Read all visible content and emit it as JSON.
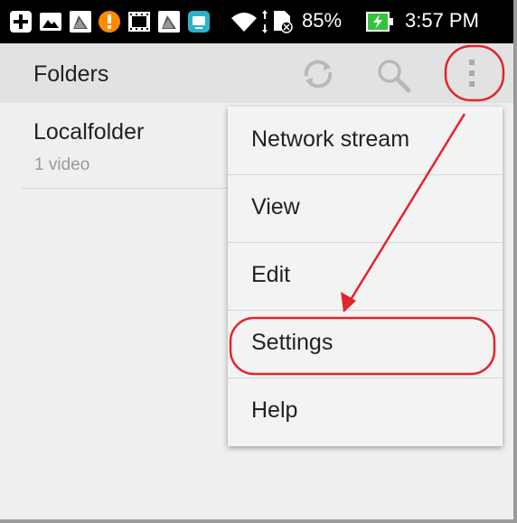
{
  "status_bar": {
    "battery_percent": "85%",
    "time": "3:57 PM",
    "icons": [
      "add-icon",
      "image-icon",
      "flag-icon",
      "alert-icon",
      "movie-icon",
      "flag-icon",
      "app-icon",
      "wifi-icon",
      "sd-card-icon",
      "battery-icon"
    ]
  },
  "app_bar": {
    "title": "Folders"
  },
  "folders": [
    {
      "name": "Localfolder",
      "count": "1 video"
    }
  ],
  "menu": {
    "items": [
      "Network stream",
      "View",
      "Edit",
      "Settings",
      "Help"
    ]
  },
  "colors": {
    "annotation": "#e3242b",
    "app_bar": "#e2e2e2",
    "status_bar": "#000000"
  }
}
